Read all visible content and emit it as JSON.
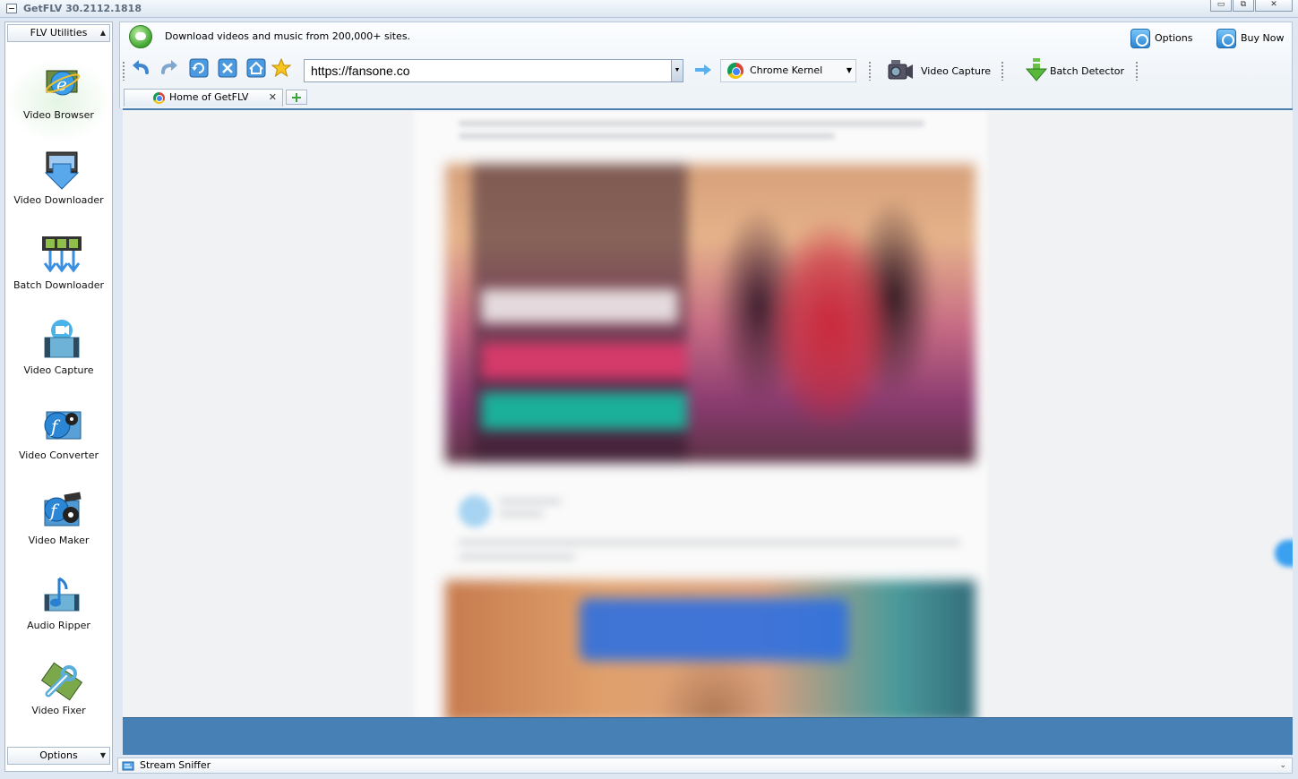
{
  "window": {
    "title": "GetFLV 30.2112.1818",
    "buttons": [
      "minimize",
      "restore",
      "close"
    ]
  },
  "sidebar": {
    "header_label": "FLV Utilities",
    "footer_label": "Options",
    "items": [
      {
        "label": "Video Browser",
        "icon": "video-browser-icon",
        "active": true
      },
      {
        "label": "Video Downloader",
        "icon": "video-downloader-icon"
      },
      {
        "label": "Batch Downloader",
        "icon": "batch-downloader-icon"
      },
      {
        "label": "Video Capture",
        "icon": "video-capture-icon"
      },
      {
        "label": "Video Converter",
        "icon": "video-converter-icon"
      },
      {
        "label": "Video Maker",
        "icon": "video-maker-icon"
      },
      {
        "label": "Audio Ripper",
        "icon": "audio-ripper-icon"
      },
      {
        "label": "Video Fixer",
        "icon": "video-fixer-icon"
      }
    ]
  },
  "header": {
    "promo_text": "Download videos and music from 200,000+ sites.",
    "options_label": "Options",
    "buy_label": "Buy Now"
  },
  "toolbar": {
    "nav_icons": [
      "back-icon",
      "forward-icon",
      "refresh-icon",
      "stop-icon",
      "home-icon",
      "favorite-star-icon"
    ],
    "url": "https://fansone.co",
    "kernel_label": "Chrome Kernel",
    "video_capture_label": "Video Capture",
    "batch_detector_label": "Batch Detector"
  },
  "tabs": [
    {
      "label": "Home of GetFLV",
      "active": true
    }
  ],
  "status": {
    "stream_sniffer_label": "Stream Sniffer"
  },
  "colors": {
    "accent_blue": "#4680b5",
    "chrome_bg": "#dfe8f2"
  }
}
